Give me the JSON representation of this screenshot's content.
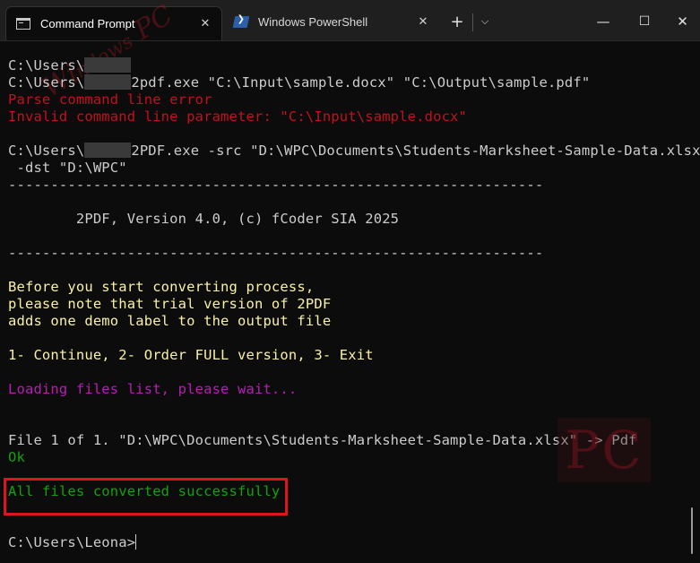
{
  "titlebar": {
    "tabs": [
      {
        "label": "Command Prompt",
        "icon": "cmd-icon",
        "close": "✕",
        "active": true
      },
      {
        "label": "Windows PowerShell",
        "icon": "powershell-icon",
        "close": "✕",
        "active": false
      }
    ],
    "new_tab": "+",
    "dropdown": "⌵",
    "minimize": "—",
    "maximize": "☐",
    "close": "✕"
  },
  "terminal": {
    "lines": [
      {
        "text": "C:\\Users\\",
        "color": "white",
        "masked": true,
        "after": ""
      },
      {
        "text": "C:\\Users\\",
        "color": "white",
        "masked": true,
        "after": "2pdf.exe \"C:\\Input\\sample.docx\" \"C:\\Output\\sample.pdf\""
      },
      {
        "text": "Parse command line error",
        "color": "red"
      },
      {
        "text": "Invalid command line parameter: \"C:\\Input\\sample.docx\"",
        "color": "red"
      },
      {
        "text": "",
        "color": "white"
      },
      {
        "text": "C:\\Users\\",
        "color": "white",
        "masked": true,
        "after": "2PDF.exe -src \"D:\\WPC\\Documents\\Students-Marksheet-Sample-Data.xlsx\""
      },
      {
        "text": " -dst \"D:\\WPC\"",
        "color": "white"
      },
      {
        "text": "---------------------------------------------------------------",
        "color": "white"
      },
      {
        "text": "",
        "color": "white"
      },
      {
        "text": "        2PDF, Version 4.0, (c) fCoder SIA 2025",
        "color": "white"
      },
      {
        "text": "",
        "color": "white"
      },
      {
        "text": "---------------------------------------------------------------",
        "color": "white"
      },
      {
        "text": "",
        "color": "white"
      },
      {
        "text": "Before you start converting process,",
        "color": "yellow"
      },
      {
        "text": "please note that trial version of 2PDF",
        "color": "yellow"
      },
      {
        "text": "adds one demo label to the output file",
        "color": "yellow"
      },
      {
        "text": "",
        "color": "white"
      },
      {
        "text": "1- Continue, 2- Order FULL version, 3- Exit",
        "color": "yellow"
      },
      {
        "text": "",
        "color": "white"
      },
      {
        "text": "Loading files list, please wait...",
        "color": "magenta"
      },
      {
        "text": "",
        "color": "white"
      },
      {
        "text": "",
        "color": "white"
      },
      {
        "text": "File 1 of 1. \"D:\\WPC\\Documents\\Students-Marksheet-Sample-Data.xlsx\" -> Pdf",
        "color": "white"
      },
      {
        "text": "Ok",
        "color": "green"
      },
      {
        "text": "",
        "color": "white"
      },
      {
        "text": "All files converted successfully",
        "color": "green"
      },
      {
        "text": "",
        "color": "white"
      },
      {
        "text": "",
        "color": "white"
      },
      {
        "text": "C:\\Users\\Leona>",
        "color": "white",
        "cursor": true
      }
    ]
  },
  "watermark": {
    "top_left": "PC",
    "bottom_right": "PC"
  },
  "colors": {
    "background": "#0c0c0c",
    "highlight": "#e0141e",
    "red": "#c50f1f",
    "yellow": "#f9f1a5",
    "magenta": "#b61db6",
    "green": "#13a10e"
  }
}
